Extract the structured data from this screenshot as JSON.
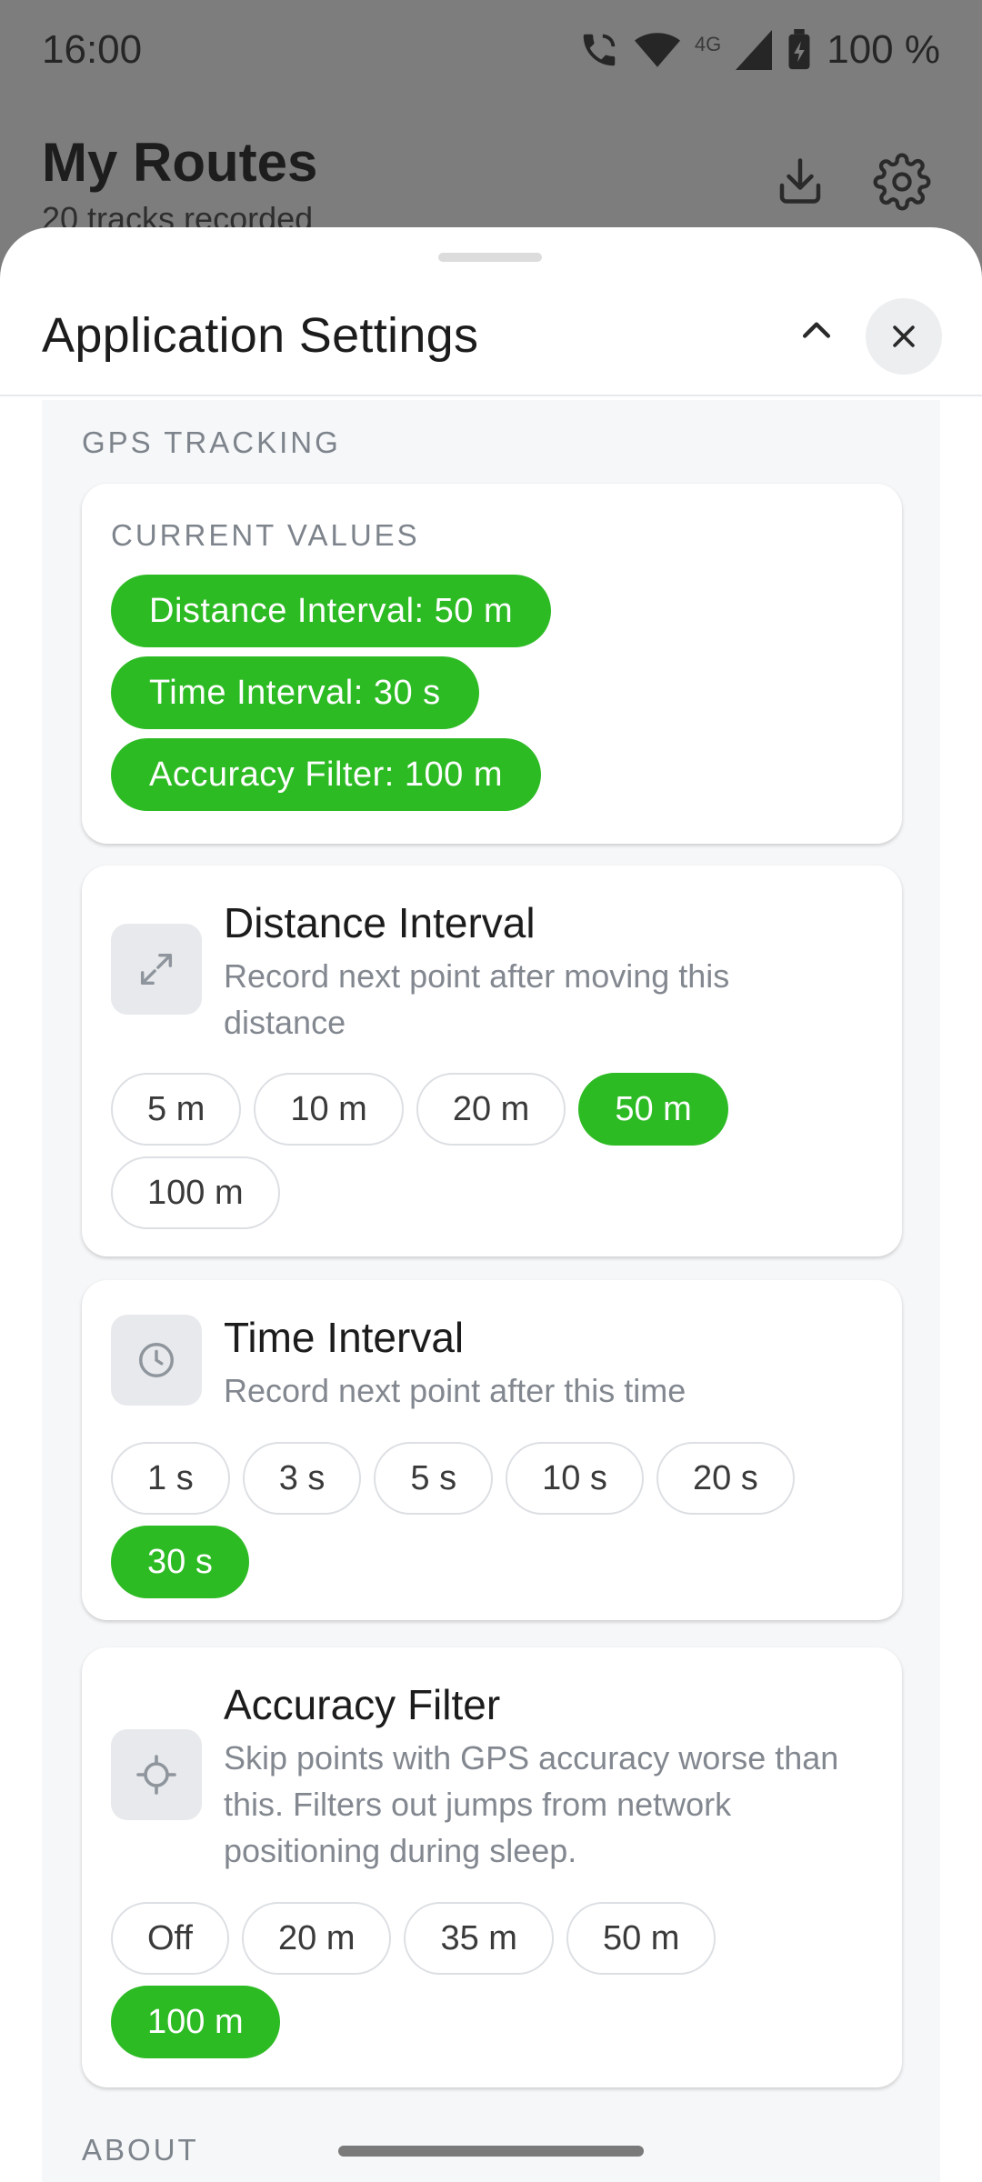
{
  "status_bar": {
    "time": "16:00",
    "battery": "100 %",
    "network": "4G"
  },
  "background_app": {
    "title": "My Routes",
    "subtitle": "20 tracks recorded"
  },
  "sheet": {
    "title": "Application Settings",
    "icons": {
      "collapse": "chevron-up-icon",
      "close": "close-icon"
    }
  },
  "gps_section": {
    "label": "GPS TRACKING",
    "current_values_label": "CURRENT VALUES",
    "current_values": [
      "Distance Interval: 50 m",
      "Time Interval: 30 s",
      "Accuracy Filter: 100 m"
    ]
  },
  "settings": [
    {
      "icon": "expand-arrows-icon",
      "title": "Distance Interval",
      "description": "Record next point after moving this distance",
      "options": [
        "5 m",
        "10 m",
        "20 m",
        "50 m",
        "100 m"
      ],
      "selected": "50 m"
    },
    {
      "icon": "clock-icon",
      "title": "Time Interval",
      "description": "Record next point after this time",
      "options": [
        "1 s",
        "3 s",
        "5 s",
        "10 s",
        "20 s",
        "30 s"
      ],
      "selected": "30 s"
    },
    {
      "icon": "crosshair-icon",
      "title": "Accuracy Filter",
      "description": "Skip points with GPS accuracy worse than this. Filters out jumps from network positioning during sleep.",
      "options": [
        "Off",
        "20 m",
        "35 m",
        "50 m",
        "100 m"
      ],
      "selected": "100 m"
    }
  ],
  "about_section": {
    "label": "ABOUT"
  },
  "colors": {
    "accent": "#2dbb24",
    "scrim": "#7d7d7d",
    "surface": "#ffffff",
    "section_bg": "#f6f7f9",
    "muted_text": "#7e848c"
  }
}
